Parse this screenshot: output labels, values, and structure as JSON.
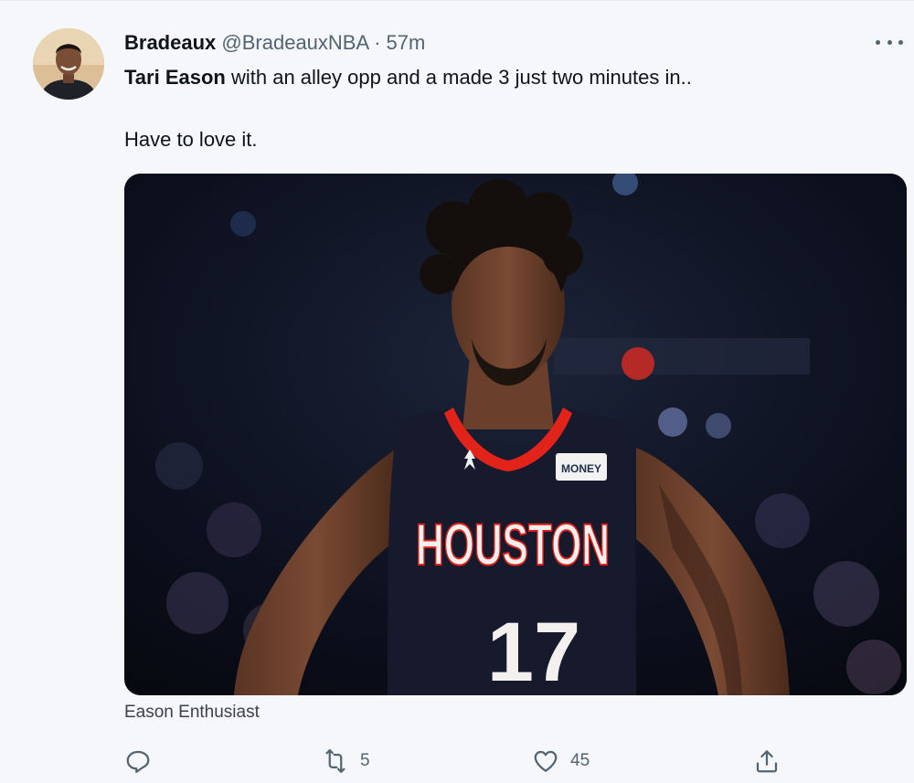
{
  "tweet": {
    "display_name": "Bradeaux",
    "handle": "@BradeauxNBA",
    "separator": "·",
    "time": "57m",
    "mention": "Tari Eason",
    "text_rest": " with an alley opp and a made 3 just two minutes in..",
    "text_line2": "Have to love it.",
    "media_caption": "Eason Enthusiast",
    "jersey_text": "HOUSTON",
    "jersey_number": "17",
    "jersey_patch": "MONEY"
  },
  "actions": {
    "retweets": "5",
    "likes": "45"
  },
  "icons": {
    "reply": "reply-icon",
    "retweet": "retweet-icon",
    "like": "heart-icon",
    "share": "share-icon",
    "more": "more-icon"
  },
  "colors": {
    "text_primary": "#0f1419",
    "text_secondary": "#536471",
    "jersey_red": "#e2231a",
    "jersey_navy": "#151a2b"
  }
}
